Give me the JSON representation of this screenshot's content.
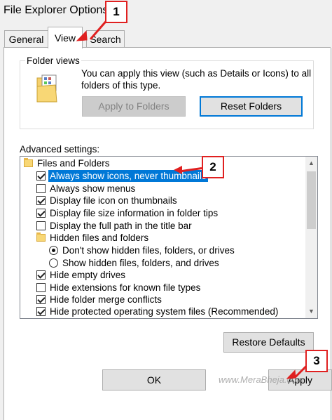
{
  "window": {
    "title": "File Explorer Options"
  },
  "tabs": [
    {
      "label": "General"
    },
    {
      "label": "View"
    },
    {
      "label": "Search"
    }
  ],
  "folder_views": {
    "group_label": "Folder views",
    "description": "You can apply this view (such as Details or Icons) to all folders of this type.",
    "apply_button": "Apply to Folders",
    "reset_button": "Reset Folders"
  },
  "advanced": {
    "label": "Advanced settings:",
    "items": [
      {
        "type": "folder",
        "label": "Files and Folders"
      },
      {
        "type": "checkbox",
        "checked": true,
        "selected": true,
        "label": "Always show icons, never thumbnails"
      },
      {
        "type": "checkbox",
        "checked": false,
        "label": "Always show menus"
      },
      {
        "type": "checkbox",
        "checked": true,
        "label": "Display file icon on thumbnails"
      },
      {
        "type": "checkbox",
        "checked": true,
        "label": "Display file size information in folder tips"
      },
      {
        "type": "checkbox",
        "checked": false,
        "label": "Display the full path in the title bar"
      },
      {
        "type": "folder",
        "label": "Hidden files and folders"
      },
      {
        "type": "radio",
        "checked": true,
        "label": "Don't show hidden files, folders, or drives"
      },
      {
        "type": "radio",
        "checked": false,
        "label": "Show hidden files, folders, and drives"
      },
      {
        "type": "checkbox",
        "checked": true,
        "label": "Hide empty drives"
      },
      {
        "type": "checkbox",
        "checked": false,
        "label": "Hide extensions for known file types"
      },
      {
        "type": "checkbox",
        "checked": true,
        "label": "Hide folder merge conflicts"
      },
      {
        "type": "checkbox",
        "checked": true,
        "label": "Hide protected operating system files (Recommended)"
      }
    ]
  },
  "buttons": {
    "restore_defaults": "Restore Defaults",
    "ok": "OK",
    "apply": "Apply"
  },
  "callouts": [
    {
      "number": "1"
    },
    {
      "number": "2"
    },
    {
      "number": "3"
    }
  ],
  "watermark": "www.MeraBheja.com",
  "colors": {
    "accent": "#0078d7",
    "callout": "#e02020"
  }
}
